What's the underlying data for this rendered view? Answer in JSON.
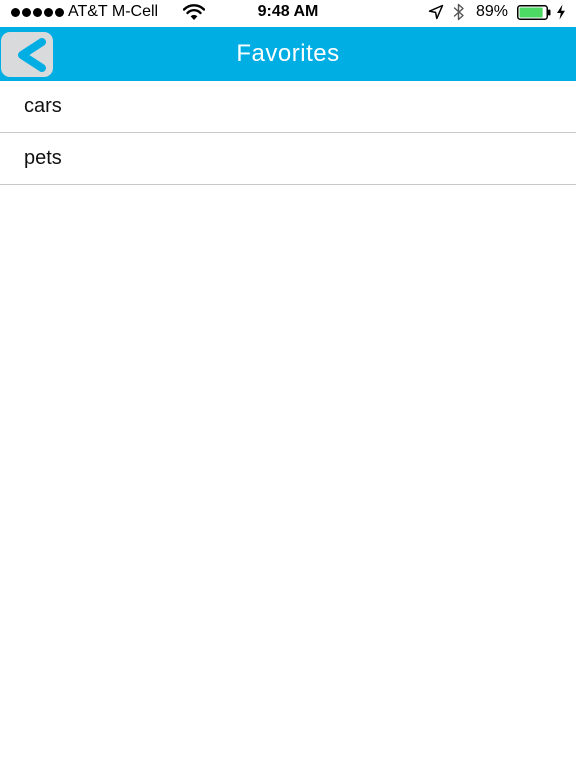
{
  "status_bar": {
    "carrier": "AT&T M-Cell",
    "time": "9:48 AM",
    "battery_percent": "89%",
    "battery_level": 0.89,
    "signal_bars": 5,
    "icons": [
      "signal-dots-icon",
      "wifi-icon",
      "location-arrow-icon",
      "bluetooth-icon",
      "battery-icon",
      "charging-bolt-icon"
    ]
  },
  "nav": {
    "title": "Favorites",
    "back_icon": "chevron-left-icon",
    "bar_color": "#00aee4",
    "back_button_color": "#d8dadc"
  },
  "favorites": {
    "items": [
      {
        "label": "cars"
      },
      {
        "label": "pets"
      }
    ]
  }
}
